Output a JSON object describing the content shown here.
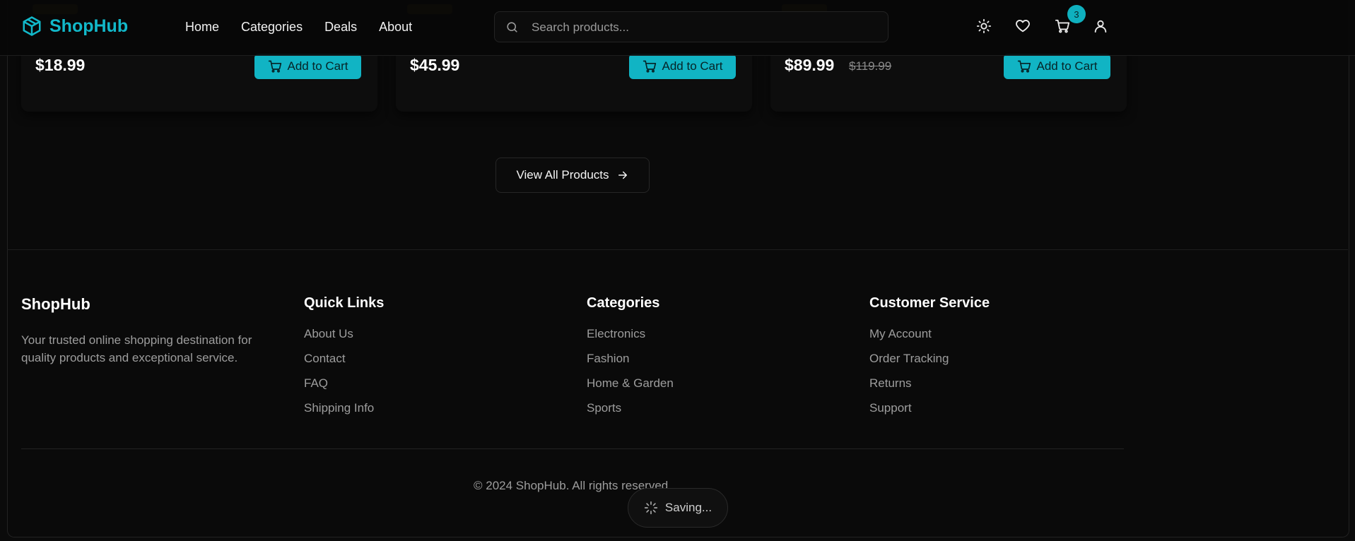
{
  "header": {
    "brand": "ShopHub",
    "nav": [
      "Home",
      "Categories",
      "Deals",
      "About"
    ],
    "search_placeholder": "Search products...",
    "cart_count": "3",
    "icons": [
      "theme-toggle-icon",
      "heart-icon",
      "cart-icon",
      "user-icon"
    ],
    "accent_color": "#12b8c9"
  },
  "products": [
    {
      "price": "$18.99",
      "old_price": "",
      "button": "Add to Cart"
    },
    {
      "price": "$45.99",
      "old_price": "",
      "button": "Add to Cart"
    },
    {
      "price": "$89.99",
      "old_price": "$119.99",
      "button": "Add to Cart"
    }
  ],
  "view_all_label": "View All Products",
  "footer": {
    "brand": "ShopHub",
    "description": "Your trusted online shopping destination for quality products and exceptional service.",
    "columns": [
      {
        "title": "Quick Links",
        "links": [
          "About Us",
          "Contact",
          "FAQ",
          "Shipping Info"
        ]
      },
      {
        "title": "Categories",
        "links": [
          "Electronics",
          "Fashion",
          "Home & Garden",
          "Sports"
        ]
      },
      {
        "title": "Customer Service",
        "links": [
          "My Account",
          "Order Tracking",
          "Returns",
          "Support"
        ]
      }
    ],
    "copyright": "© 2024 ShopHub. All rights reserved."
  },
  "toast": {
    "label": "Saving..."
  }
}
